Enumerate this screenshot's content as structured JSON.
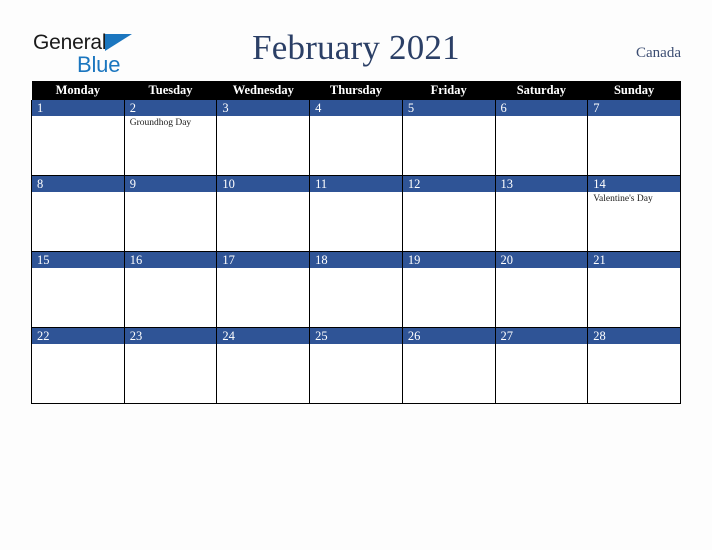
{
  "logo": {
    "word1": "General",
    "word2": "Blue",
    "triangle_color": "#1b76bf"
  },
  "header": {
    "title": "February 2021",
    "country": "Canada",
    "title_color": "#2b3f66"
  },
  "calendar": {
    "weekday_headers": [
      "Monday",
      "Tuesday",
      "Wednesday",
      "Thursday",
      "Friday",
      "Saturday",
      "Sunday"
    ],
    "header_bg": "#000000",
    "daynum_bg": "#2f5496",
    "weeks": [
      [
        {
          "day": "1",
          "events": []
        },
        {
          "day": "2",
          "events": [
            "Groundhog Day"
          ]
        },
        {
          "day": "3",
          "events": []
        },
        {
          "day": "4",
          "events": []
        },
        {
          "day": "5",
          "events": []
        },
        {
          "day": "6",
          "events": []
        },
        {
          "day": "7",
          "events": []
        }
      ],
      [
        {
          "day": "8",
          "events": []
        },
        {
          "day": "9",
          "events": []
        },
        {
          "day": "10",
          "events": []
        },
        {
          "day": "11",
          "events": []
        },
        {
          "day": "12",
          "events": []
        },
        {
          "day": "13",
          "events": []
        },
        {
          "day": "14",
          "events": [
            "Valentine's Day"
          ]
        }
      ],
      [
        {
          "day": "15",
          "events": []
        },
        {
          "day": "16",
          "events": []
        },
        {
          "day": "17",
          "events": []
        },
        {
          "day": "18",
          "events": []
        },
        {
          "day": "19",
          "events": []
        },
        {
          "day": "20",
          "events": []
        },
        {
          "day": "21",
          "events": []
        }
      ],
      [
        {
          "day": "22",
          "events": []
        },
        {
          "day": "23",
          "events": []
        },
        {
          "day": "24",
          "events": []
        },
        {
          "day": "25",
          "events": []
        },
        {
          "day": "26",
          "events": []
        },
        {
          "day": "27",
          "events": []
        },
        {
          "day": "28",
          "events": []
        }
      ]
    ]
  }
}
